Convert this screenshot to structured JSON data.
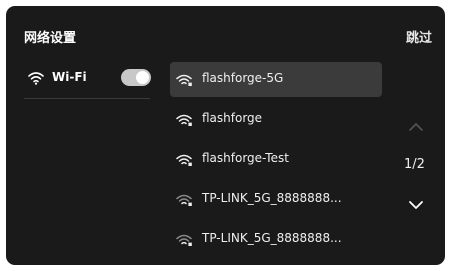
{
  "header": {
    "title": "网络设置",
    "skip_label": "跳过"
  },
  "wifi": {
    "label": "Wi-Fi",
    "enabled": true,
    "icon": "wifi-icon"
  },
  "networks": [
    {
      "ssid": "flashforge-5G",
      "selected": true,
      "signal": "strong"
    },
    {
      "ssid": "flashforge",
      "selected": false,
      "signal": "strong"
    },
    {
      "ssid": "flashforge-Test",
      "selected": false,
      "signal": "strong"
    },
    {
      "ssid": "TP-LINK_5G_8888888...",
      "selected": false,
      "signal": "weak"
    },
    {
      "ssid": "TP-LINK_5G_8888888...",
      "selected": false,
      "signal": "weak"
    }
  ],
  "pagination": {
    "current": 1,
    "total": 2,
    "label": "1/2"
  },
  "colors": {
    "background": "#1a1a1a",
    "selected_row": "#3b3b3b",
    "text": "#f0f0f0",
    "toggle_on": "#c8c8c8",
    "disabled_arrow": "#555555"
  }
}
